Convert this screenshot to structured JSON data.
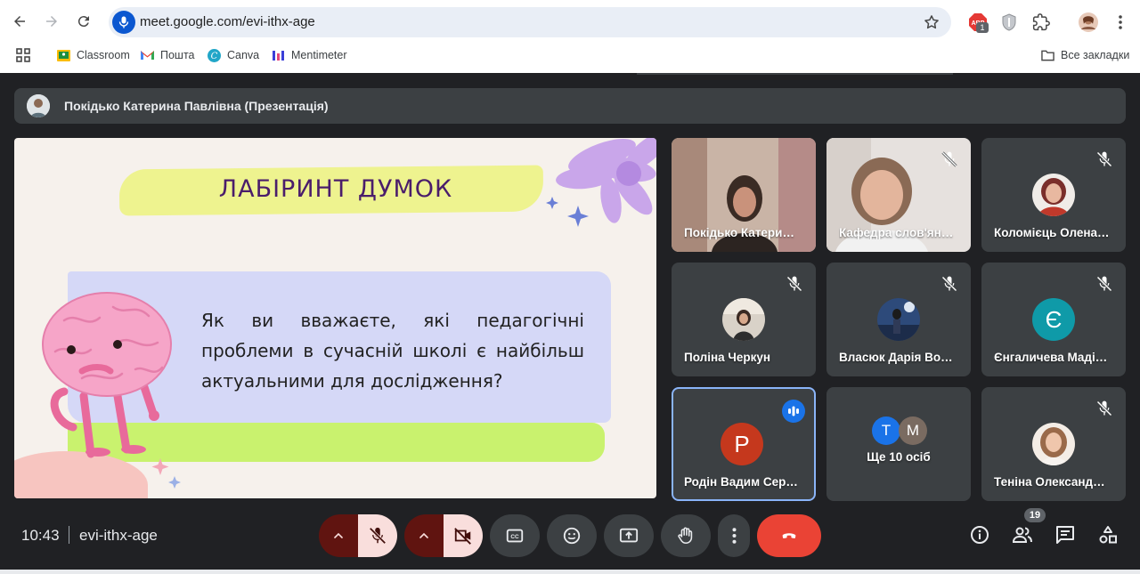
{
  "browser": {
    "url": "meet.google.com/evi-ithx-age",
    "extension_badge": "1",
    "bookmarks": [
      {
        "label": "Classroom",
        "icon": "classroom-icon"
      },
      {
        "label": "Пошта",
        "icon": "gmail-icon"
      },
      {
        "label": "Canva",
        "icon": "canva-icon"
      },
      {
        "label": "Mentimeter",
        "icon": "mentimeter-icon"
      }
    ],
    "all_bookmarks_label": "Все закладки"
  },
  "meet": {
    "presenter_label": "Покідько Катерина Павлівна (Презентація)",
    "slide": {
      "title": "ЛАБІРИНТ ДУМОК",
      "question": "Як ви вважаєте, які педагогічні проблеми в сучасній школі є найбільш актуальними для дослідження?"
    },
    "tiles": [
      {
        "name": "Покідько Катери…",
        "type": "video",
        "muted": false
      },
      {
        "name": "Кафедра слов'ян…",
        "type": "video",
        "muted": true
      },
      {
        "name": "Коломієць Олена…",
        "type": "photo",
        "muted": true
      },
      {
        "name": "Поліна Черкун",
        "type": "photo",
        "muted": true
      },
      {
        "name": "Власюк Дарія Во…",
        "type": "photo",
        "muted": true
      },
      {
        "name": "Єнгаличева Маді…",
        "type": "letter",
        "letter": "Є",
        "color": "#0f9aa8",
        "muted": true
      },
      {
        "name": "Родін Вадим Сер…",
        "type": "letter",
        "letter": "Р",
        "color": "#c5381d",
        "speaking": true
      },
      {
        "name": "Ще 10 осіб",
        "type": "group",
        "letters": [
          "Т",
          "М"
        ]
      },
      {
        "name": "Теніна Олександ…",
        "type": "photo",
        "muted": true
      }
    ],
    "time": "10:43",
    "meeting_code": "evi-ithx-age",
    "people_count": "19",
    "colors": {
      "background": "#202124",
      "tile": "#3c4043",
      "end_call": "#ea4335",
      "accent": "#8ab4f8"
    }
  }
}
